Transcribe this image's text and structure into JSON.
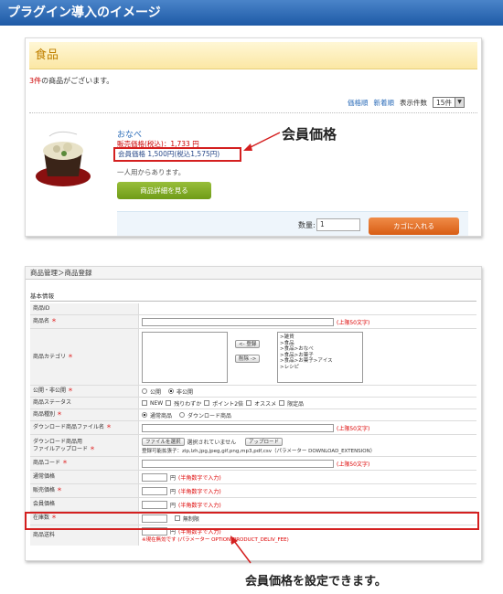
{
  "banner": {
    "title": "プラグイン導入のイメージ"
  },
  "front": {
    "category_title": "食品",
    "count_num": "3件",
    "count_text": "の商品がございます。",
    "sort_price": "価格順",
    "sort_new": "新着順",
    "perpage_label": "表示件数",
    "perpage_value": "15件",
    "product_name": "おなべ",
    "normal_price": "販売価格(税込)：1,733 円",
    "member_price": "会員価格 1,500円(税込1,575円)",
    "note": "一人用からあります。",
    "detail_button": "商品詳細を見る",
    "qty_label": "数量:",
    "qty_value": "1",
    "cart_button": "カゴに入れる",
    "callout": "会員価格"
  },
  "admin": {
    "title": "商品管理＞商品登録",
    "section": "基本情報",
    "rows": {
      "id": "商品ID",
      "name": "商品名",
      "category": "商品カテゴリ",
      "status_public": "公開・非公開",
      "status": "商品ステータス",
      "type": "商品種別",
      "dl_filename": "ダウンロード商品ファイル名",
      "dl_upload_1": "ダウンロード商品用",
      "dl_upload_2": "ファイルアップロード",
      "code": "商品コード",
      "normal_price": "通常価格",
      "sale_price": "販売価格",
      "member_price": "会員価格",
      "stock": "在庫数",
      "shipping": "商品送料"
    },
    "required_mark": "＊",
    "limit50": "(上限50文字)",
    "btn_register": "<- 登録",
    "btn_delete": "削除 ->",
    "categories": [
      ">雑貨",
      ">食品",
      ">食品>おなべ",
      ">食品>お菓子",
      ">食品>お菓子>アイス",
      ">レシピ"
    ],
    "radio_public": "公開",
    "radio_private": "非公開",
    "status_opts": [
      "NEW",
      "残りわずか",
      "ポイント2倍",
      "オススメ",
      "限定品"
    ],
    "type_normal": "通常商品",
    "type_download": "ダウンロード商品",
    "file_button": "ファイルを選択",
    "file_none": "選択されていません",
    "upload_button": "アップロード",
    "ext_note": "登録可能拡張子：zip,lzh,jpg,jpeg,gif,png,mp3,pdf,csv（パラメーター DOWNLOAD_EXTENSION）",
    "yen": "円",
    "halfwidth": "(半角数字で入力)",
    "unlimited": "無制限",
    "shipping_note": "※現在無効です (パラメーター OPTION_PRODUCT_DELIV_FEE)",
    "callout": "会員価格を設定できます。"
  }
}
